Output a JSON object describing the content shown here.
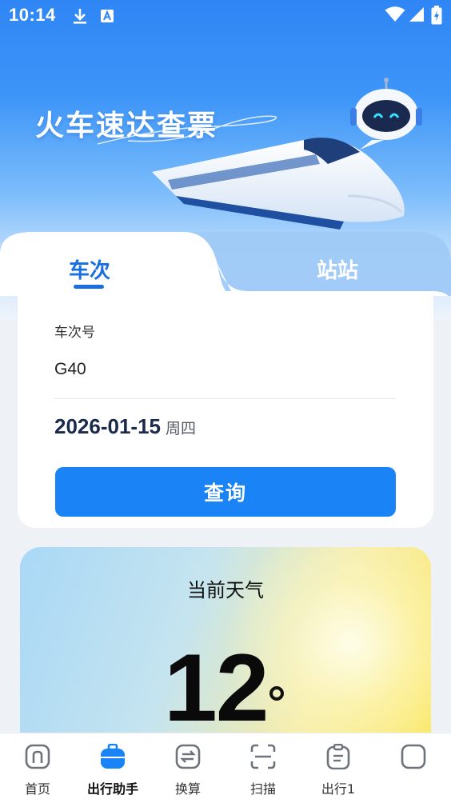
{
  "status_bar": {
    "time": "10:14"
  },
  "hero": {
    "title": "火车速达查票"
  },
  "tabs": [
    {
      "label": "车次",
      "active": true
    },
    {
      "label": "站站",
      "active": false
    }
  ],
  "search_form": {
    "train_label": "车次号",
    "train_value": "G40",
    "date_value": "2026-01-15",
    "weekday": "周四",
    "query_button": "查询"
  },
  "weather": {
    "title": "当前天气",
    "temperature": "12"
  },
  "bottom_nav": [
    {
      "label": "首页",
      "icon": "home-icon",
      "active": false
    },
    {
      "label": "出行助手",
      "icon": "assistant-icon",
      "active": true
    },
    {
      "label": "换算",
      "icon": "convert-icon",
      "active": false
    },
    {
      "label": "扫描",
      "icon": "scan-icon",
      "active": false
    },
    {
      "label": "出行1",
      "icon": "clipboard-icon",
      "active": false
    },
    {
      "label": "",
      "icon": "square-icon",
      "active": false
    }
  ],
  "colors": {
    "accent": "#1a84f7",
    "tab_active": "#1a6fe0",
    "hero": "#2f86f5"
  }
}
